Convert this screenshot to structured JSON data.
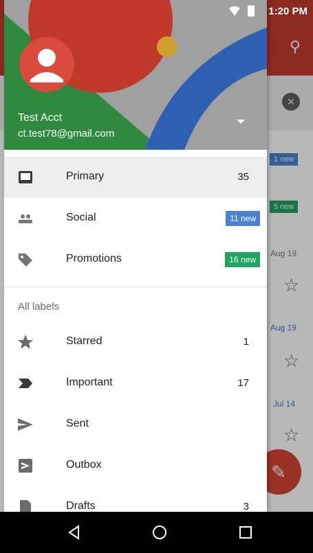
{
  "status_bar": {
    "time": "1:20 PM"
  },
  "account": {
    "name": "Test Acct",
    "email": "ct.test78@gmail.com"
  },
  "primary_items": [
    {
      "label": "Primary",
      "count": "35",
      "icon": "inbox-icon"
    },
    {
      "label": "Social",
      "badge": "11 new",
      "badge_color": "#4a83d4",
      "icon": "people-icon"
    },
    {
      "label": "Promotions",
      "badge": "16 new",
      "badge_color": "#1fa463",
      "icon": "tag-icon"
    }
  ],
  "section_label": "All labels",
  "label_items": [
    {
      "label": "Starred",
      "count": "1",
      "icon": "star-icon"
    },
    {
      "label": "Important",
      "count": "17",
      "icon": "important-icon"
    },
    {
      "label": "Sent",
      "count": "",
      "icon": "send-icon"
    },
    {
      "label": "Outbox",
      "count": "",
      "icon": "outbox-icon"
    },
    {
      "label": "Drafts",
      "count": "3",
      "icon": "draft-icon"
    }
  ],
  "background": {
    "badge1": "1 new",
    "badge2": "5 new",
    "date1": "Aug 19",
    "date2": "Aug 19",
    "date3": "Jul 14"
  },
  "colors": {
    "accent_red": "#d94a3c",
    "header_blue": "#2f5fb0",
    "header_green": "#2f8a3f",
    "social_badge": "#4a83d4",
    "promo_badge": "#1fa463"
  }
}
